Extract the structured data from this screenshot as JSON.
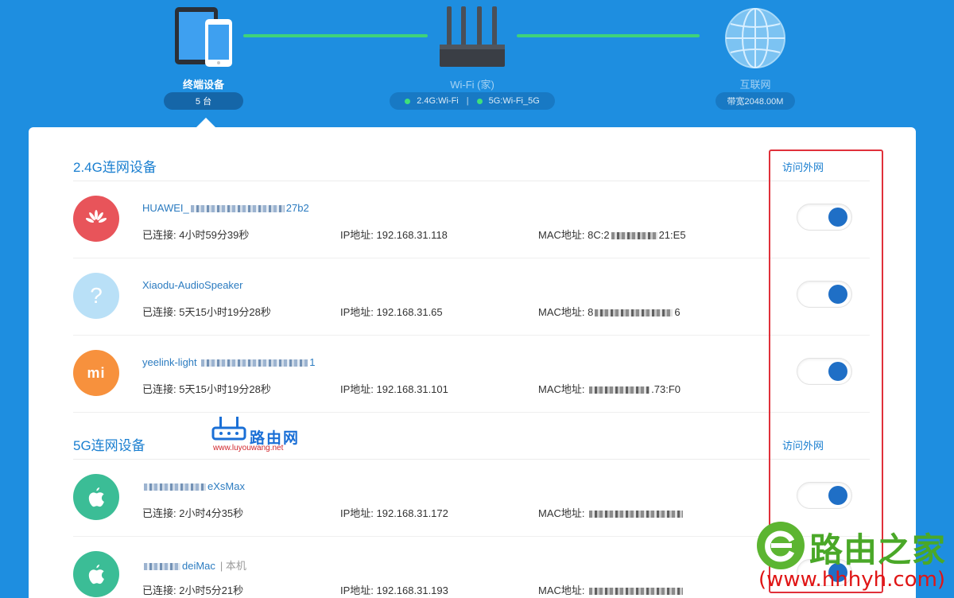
{
  "topology": {
    "devices_label": "终端设备",
    "devices_count": "5 台",
    "wifi_label": "Wi-Fi (家)",
    "wifi_24": "2.4G:Wi-Fi",
    "wifi_sep": "|",
    "wifi_5": "5G:Wi-Fi_5G",
    "internet_label": "互联网",
    "bandwidth": "带宽2048.00M"
  },
  "sections": [
    {
      "title": "2.4G连网设备",
      "access_label": "访问外网"
    },
    {
      "title": "5G连网设备",
      "access_label": "访问外网"
    }
  ],
  "devices": [
    {
      "name_prefix": "HUAWEI_",
      "name_suffix": "27b2",
      "connected": "已连接: 4小时59分39秒",
      "ip": "IP地址: 192.168.31.118",
      "mac_prefix": "MAC地址: 8C:2",
      "mac_suffix": "21:E5",
      "avatar_icon": "huawei-logo-icon",
      "avatar_color": "#e8545a",
      "access_enabled": true
    },
    {
      "name_prefix": "Xiaodu-AudioSpeaker",
      "name_suffix": "",
      "connected": "已连接: 5天15小时19分28秒",
      "ip": "IP地址: 192.168.31.65",
      "mac_prefix": "MAC地址: 8",
      "mac_suffix": "6",
      "avatar_icon": "question-icon",
      "avatar_color": "#b9e0f7",
      "access_enabled": true
    },
    {
      "name_prefix": "yeelink-light",
      "name_suffix": "1",
      "connected": "已连接: 5天15小时19分28秒",
      "ip": "IP地址: 192.168.31.101",
      "mac_prefix": "MAC地址:",
      "mac_suffix": ".73:F0",
      "avatar_icon": "mi-logo-icon",
      "avatar_color": "#f7913d",
      "access_enabled": true
    },
    {
      "name_prefix": "",
      "name_suffix": "eXsMax",
      "connected": "已连接: 2小时4分35秒",
      "ip": "IP地址: 192.168.31.172",
      "mac_prefix": "MAC地址:",
      "mac_suffix": "",
      "avatar_icon": "apple-icon",
      "avatar_color": "#3bbd96",
      "access_enabled": true
    },
    {
      "name_prefix": "",
      "name_suffix": "deiMac",
      "self_tag": "| 本机",
      "connected": "已连接: 2小时5分21秒",
      "ip": "IP地址: 192.168.31.193",
      "mac_prefix": "MAC地址:",
      "mac_suffix": "",
      "avatar_icon": "apple-icon",
      "avatar_color": "#3bbd96",
      "access_enabled": true
    }
  ],
  "watermarks": {
    "luyouwang_title": "路由网",
    "luyouwang_url": "www.luyouwang.net",
    "hhhyh_title": "路由之家",
    "hhhyh_url": "(www.hhhyh.com)"
  }
}
